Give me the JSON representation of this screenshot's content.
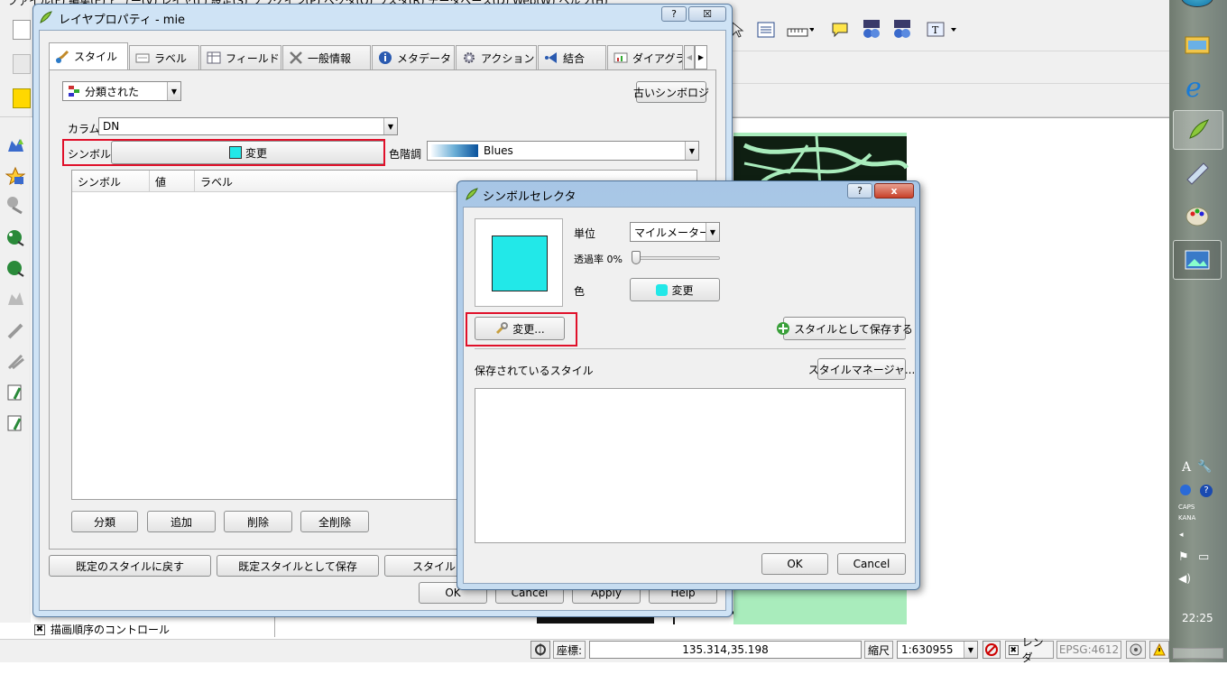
{
  "top_menu": {
    "text": "ファイル(F)  編集(E)  ビュー(V)  レイヤ(L)  設定(S)  プラグイン(P)  ベクタ(O)  ラスタ(R)  データベース(D)  Web(W)  ヘルプ(H)"
  },
  "layer_dialog": {
    "title": "レイヤプロパティ - mie",
    "title_help": "?",
    "title_close": "☒",
    "tabs": [
      "スタイル",
      "ラベル",
      "フィールド",
      "一般情報",
      "メタデータ",
      "アクション",
      "結合",
      "ダイアグラム"
    ],
    "renderer_select": "分類された",
    "old_symbology_button": "古いシンボロジ",
    "column_label": "カラム",
    "column_value": "DN",
    "symbol_label": "シンボル",
    "symbol_change_button": "変更",
    "color_ramp_label": "色階調",
    "color_ramp_value": "Blues",
    "table_headers": [
      "シンボル",
      "値",
      "ラベル"
    ],
    "classify_button": "分類",
    "add_button": "追加",
    "delete_button": "削除",
    "delete_all_button": "全削除",
    "restore_default_button": "既定のスタイルに戻す",
    "save_default_button": "既定スタイルとして保存",
    "style_button": "スタイル",
    "ok_button": "OK",
    "cancel_button": "Cancel",
    "apply_button": "Apply",
    "help_button": "Help"
  },
  "symbol_selector": {
    "title": "シンボルセレクタ",
    "title_help": "?",
    "title_close": "x",
    "unit_label": "単位",
    "unit_value": "マイルメーター",
    "transparency_label": "透過率 0%",
    "transparency_value": 0,
    "color_label": "色",
    "color_change_button": "変更",
    "change_button": "変更...",
    "save_style_button": "スタイルとして保存する",
    "saved_styles_label": "保存されているスタイル",
    "style_manager_button": "スタイルマネージャ...",
    "ok_button": "OK",
    "cancel_button": "Cancel",
    "symbol_color": "#22e8e8"
  },
  "bottom": {
    "layer_order_label": "描画順序のコントロール",
    "coord_label": "座標:",
    "coord_value": "135.314,35.198",
    "scale_label": "縮尺",
    "scale_value": "1:630955",
    "render_label": "レンダ",
    "epsg_label": "EPSG:4612"
  },
  "taskbar": {
    "time": "22:25",
    "caps": "CAPS",
    "kana": "KANA"
  }
}
